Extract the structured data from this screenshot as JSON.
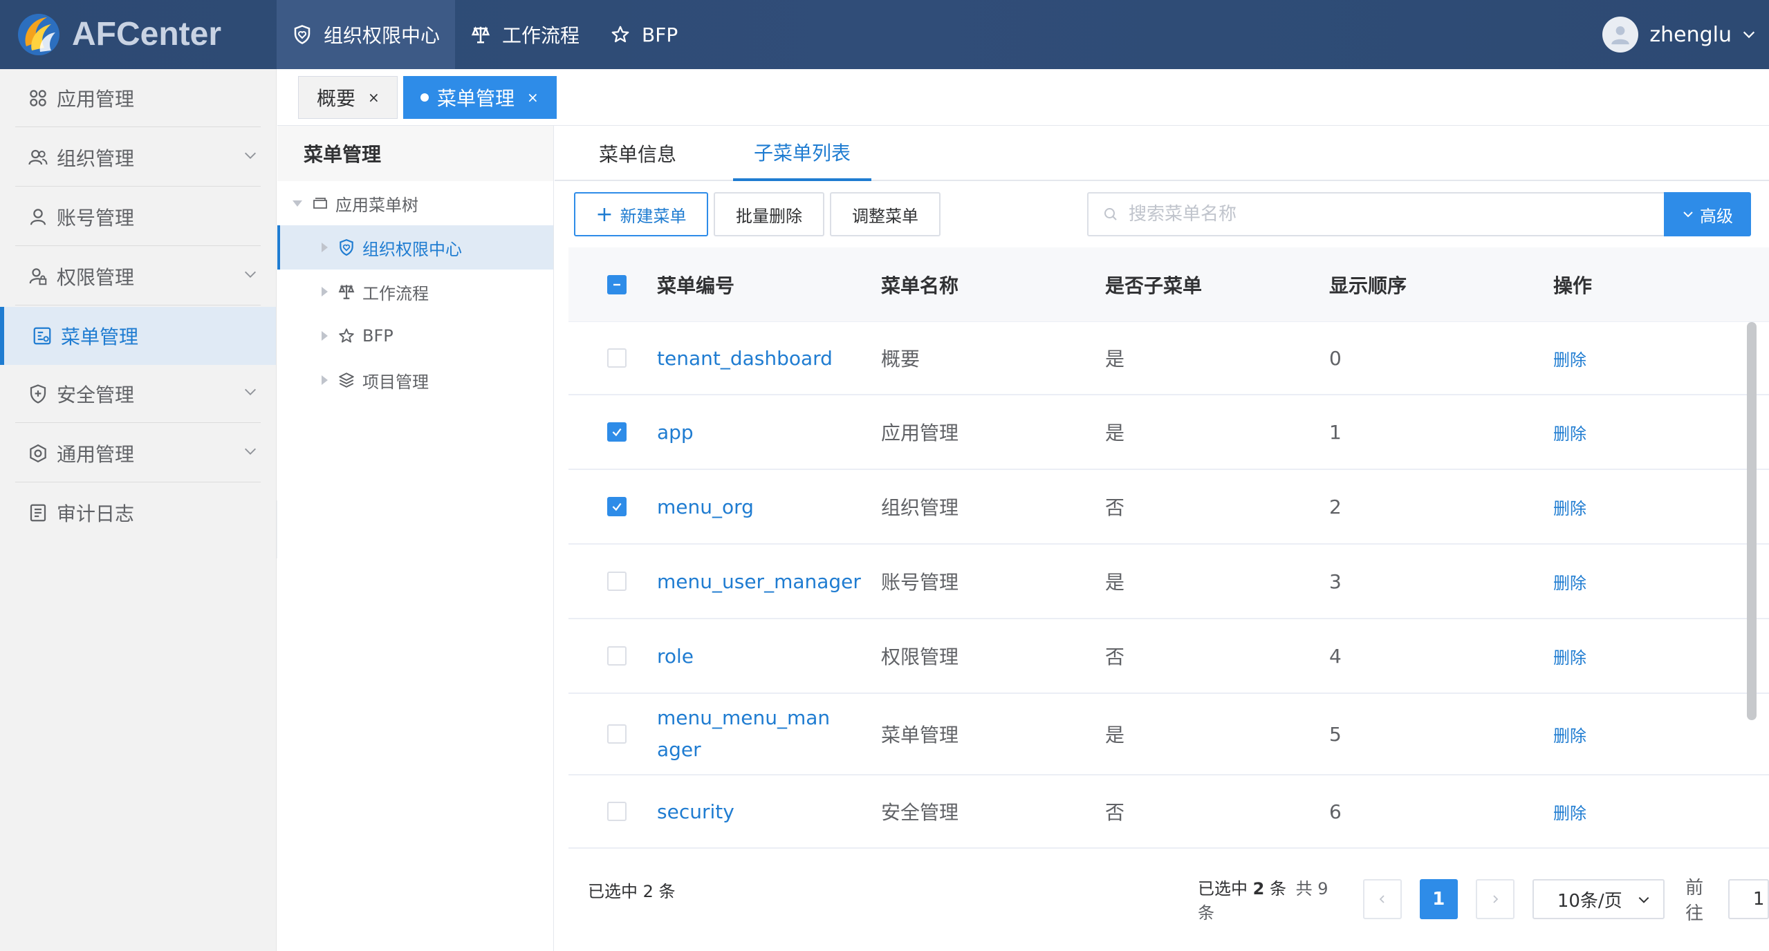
{
  "app": {
    "brand": "AFCenter"
  },
  "topnav": [
    {
      "label": "组织权限中心",
      "icon": "shield-heart-icon",
      "active": true
    },
    {
      "label": "工作流程",
      "icon": "scale-icon",
      "active": false
    },
    {
      "label": "BFP",
      "icon": "star-icon",
      "active": false
    }
  ],
  "user": {
    "name": "zhenglu"
  },
  "sidebar": {
    "items": [
      {
        "label": "应用管理",
        "icon": "grid-icon"
      },
      {
        "label": "组织管理",
        "icon": "users-icon",
        "expandable": true
      },
      {
        "label": "账号管理",
        "icon": "user-icon"
      },
      {
        "label": "权限管理",
        "icon": "user-lock-icon",
        "expandable": true
      },
      {
        "label": "菜单管理",
        "icon": "menu-doc-icon",
        "active": true
      },
      {
        "label": "安全管理",
        "icon": "shield-plus-icon",
        "expandable": true
      },
      {
        "label": "通用管理",
        "icon": "settings-icon",
        "expandable": true
      },
      {
        "label": "审计日志",
        "icon": "log-icon"
      }
    ]
  },
  "page_tabs": [
    {
      "label": "概要",
      "close": "×"
    },
    {
      "label": "菜单管理",
      "close": "×",
      "active": true
    }
  ],
  "tree": {
    "title": "菜单管理",
    "root": "应用菜单树",
    "nodes": [
      {
        "label": "组织权限中心",
        "icon": "shield-heart-icon",
        "selected": true
      },
      {
        "label": "工作流程",
        "icon": "scale-icon"
      },
      {
        "label": "BFP",
        "icon": "star-icon"
      },
      {
        "label": "项目管理",
        "icon": "layers-icon"
      }
    ]
  },
  "content_tabs": [
    {
      "label": "菜单信息"
    },
    {
      "label": "子菜单列表",
      "active": true
    }
  ],
  "toolbar": {
    "new_label": "新建菜单",
    "batch_delete_label": "批量删除",
    "adjust_label": "调整菜单",
    "search_placeholder": "搜索菜单名称",
    "search_value": "",
    "advanced_label": "高级"
  },
  "table": {
    "headers": [
      "菜单编号",
      "菜单名称",
      "是否子菜单",
      "显示顺序",
      "操作"
    ],
    "rows": [
      {
        "code": "tenant_dashboard",
        "name": "概要",
        "is_sub": "是",
        "order": "0",
        "action": "删除",
        "checked": false
      },
      {
        "code": "app",
        "name": "应用管理",
        "is_sub": "是",
        "order": "1",
        "action": "删除",
        "checked": true
      },
      {
        "code": "menu_org",
        "name": "组织管理",
        "is_sub": "否",
        "order": "2",
        "action": "删除",
        "checked": true
      },
      {
        "code": "menu_user_manager",
        "name": "账号管理",
        "is_sub": "是",
        "order": "3",
        "action": "删除",
        "checked": false
      },
      {
        "code": "role",
        "name": "权限管理",
        "is_sub": "否",
        "order": "4",
        "action": "删除",
        "checked": false
      },
      {
        "code": "menu_menu_manager",
        "name": "菜单管理",
        "is_sub": "是",
        "order": "5",
        "action": "删除",
        "checked": false
      },
      {
        "code": "security",
        "name": "安全管理",
        "is_sub": "否",
        "order": "6",
        "action": "删除",
        "checked": false
      }
    ]
  },
  "footer": {
    "selected_text": "已选中 2 条",
    "pager_selected_prefix": "已选中 ",
    "pager_selected_count": "2",
    "pager_selected_suffix": " 条",
    "pager_total": "共 9 条",
    "current_page": "1",
    "page_size": "10条/页",
    "goto_label": "前往",
    "goto_value": "1"
  },
  "colors": {
    "header_bg": "#2d4a73",
    "accent": "#2e8ce8",
    "link": "#1f7cd1",
    "sidebar_bg": "#f2f2f2"
  }
}
